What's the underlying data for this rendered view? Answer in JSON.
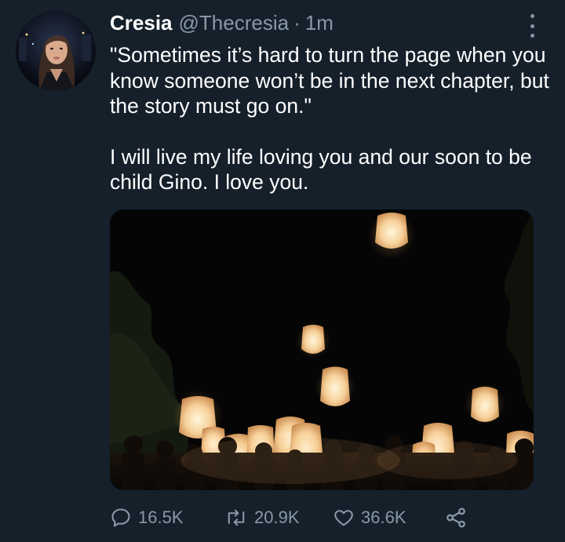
{
  "tweet": {
    "author_name": "Cresia",
    "author_handle": "@Thecresia",
    "separator": "·",
    "timestamp": "1m",
    "text_paragraphs": [
      "\"Sometimes it’s hard to turn the page when you know someone won’t be in the next chapter, but the story must go on.\"",
      "I will live my life loving you and our soon to be child Gino. I love you."
    ],
    "stats": {
      "replies": "16.5K",
      "retweets": "20.9K",
      "likes": "36.6K"
    }
  },
  "icons": {
    "more": "more-options-icon",
    "reply": "reply-icon",
    "retweet": "retweet-icon",
    "like": "heart-icon",
    "share": "share-icon"
  },
  "colors": {
    "background": "#15202b",
    "text": "#ffffff",
    "secondary_text": "#8899a6",
    "lantern_glow": "#f6c98a"
  }
}
